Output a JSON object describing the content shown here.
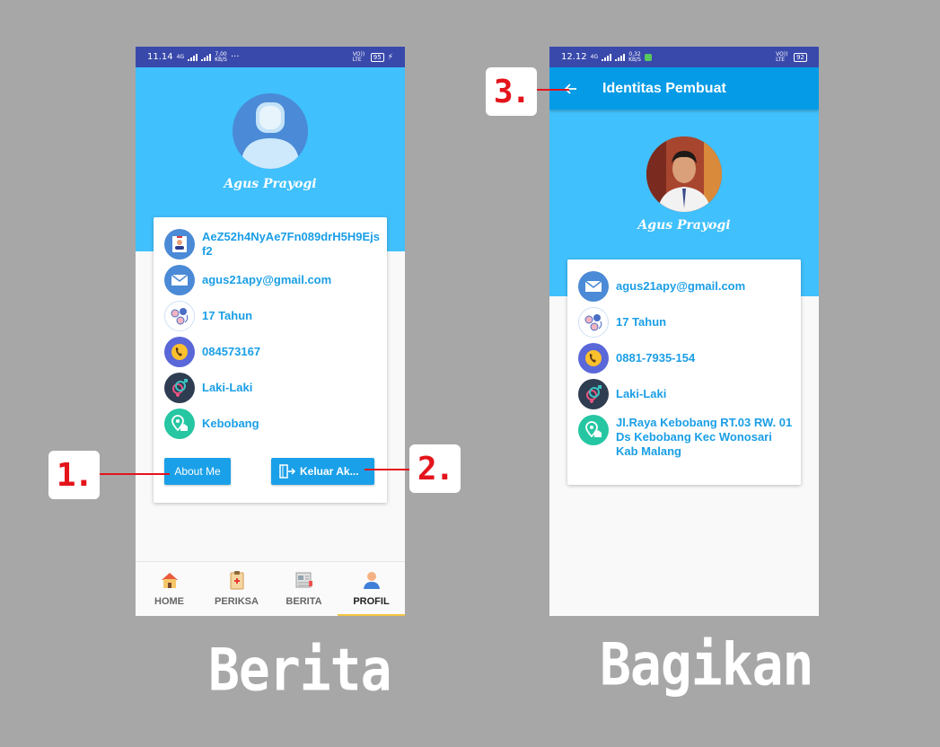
{
  "left_phone": {
    "status": {
      "time": "11.14",
      "net_small": "4G",
      "speed_value": "7,00",
      "speed_unit": "KB/S",
      "dots": "···",
      "volte_1": "VO)) LTE",
      "battery": "95"
    },
    "name": "Agus Prayogi",
    "card": {
      "rows": [
        {
          "icon": "id-card-icon",
          "text": "AeZ52h4NyAe7Fn089drH5H9Ejsf2"
        },
        {
          "icon": "email-icon",
          "text": "agus21apy@gmail.com"
        },
        {
          "icon": "age-icon",
          "text": "17 Tahun"
        },
        {
          "icon": "phone-icon",
          "text": "084573167"
        },
        {
          "icon": "gender-icon",
          "text": "Laki-Laki"
        },
        {
          "icon": "location-icon",
          "text": "Kebobang"
        }
      ],
      "about_label": "About Me",
      "logout_label": "Keluar Ak..."
    },
    "nav": [
      {
        "label": "HOME",
        "icon": "home-icon"
      },
      {
        "label": "PERIKSA",
        "icon": "clipboard-icon"
      },
      {
        "label": "BERITA",
        "icon": "news-icon"
      },
      {
        "label": "PROFIL",
        "icon": "profile-icon",
        "active": true
      }
    ]
  },
  "right_phone": {
    "status": {
      "time": "12.12",
      "net_small": "4G",
      "speed_value": "0,32",
      "speed_unit": "KB/S",
      "volte_1": "VO)) LTE",
      "battery": "92"
    },
    "appbar_title": "Identitas Pembuat",
    "name": "Agus Prayogi",
    "card": {
      "rows": [
        {
          "icon": "email-icon",
          "text": "agus21apy@gmail.com"
        },
        {
          "icon": "age-icon",
          "text": "17 Tahun"
        },
        {
          "icon": "phone-icon",
          "text": "0881-7935-154"
        },
        {
          "icon": "gender-icon",
          "text": "Laki-Laki"
        },
        {
          "icon": "location-icon",
          "text": "Jl.Raya Kebobang RT.03 RW. 01 Ds Kebobang Kec Wonosari Kab Malang"
        }
      ]
    }
  },
  "callouts": {
    "one": "1.",
    "two": "2.",
    "three": "3."
  },
  "captions": {
    "left": "Berita",
    "right": "Bagikan"
  },
  "colors": {
    "accent_blue": "#40c0fc",
    "appbar_blue": "#059be6",
    "text_blue": "#1a9ee6",
    "status_bar": "#3949ab",
    "callout_red": "#e4141b"
  }
}
